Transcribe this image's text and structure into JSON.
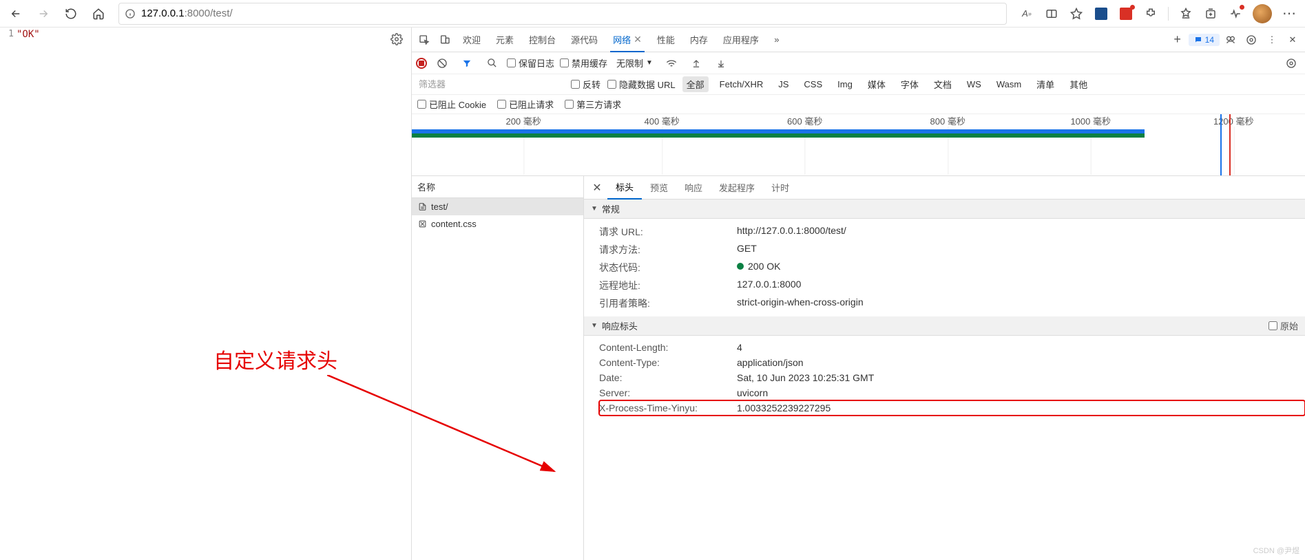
{
  "browser": {
    "url_host": "127.0.0.1",
    "url_port_path": ":8000/test/",
    "reader_label": "A",
    "issue_count": "14"
  },
  "page": {
    "line_no": "1",
    "body": "\"OK\"",
    "annotation": "自定义请求头",
    "watermark": "CSDN @尹煜"
  },
  "devtools": {
    "tabs": [
      "欢迎",
      "元素",
      "控制台",
      "源代码",
      "网络",
      "性能",
      "内存",
      "应用程序"
    ],
    "active_tab_index": 4,
    "toolbar": {
      "preserve_log": "保留日志",
      "disable_cache": "禁用缓存",
      "throttle": "无限制"
    },
    "filter": {
      "placeholder": "筛选器",
      "invert": "反转",
      "hide_data_urls": "隐藏数据 URL",
      "types": [
        "全部",
        "Fetch/XHR",
        "JS",
        "CSS",
        "Img",
        "媒体",
        "字体",
        "文档",
        "WS",
        "Wasm",
        "清单",
        "其他"
      ]
    },
    "cookies": {
      "blocked_cookies": "已阻止 Cookie",
      "blocked_requests": "已阻止请求",
      "third_party": "第三方请求"
    },
    "waterfall": {
      "ticks": [
        "200 毫秒",
        "400 毫秒",
        "600 毫秒",
        "800 毫秒",
        "1000 毫秒",
        "1200 毫秒"
      ]
    },
    "requests": {
      "col_name": "名称",
      "items": [
        "test/",
        "content.css"
      ]
    },
    "detail_tabs": [
      "标头",
      "预览",
      "响应",
      "发起程序",
      "计时"
    ],
    "general": {
      "title": "常规",
      "rows": [
        {
          "k": "请求 URL:",
          "v": "http://127.0.0.1:8000/test/"
        },
        {
          "k": "请求方法:",
          "v": "GET"
        },
        {
          "k": "状态代码:",
          "v": "200 OK",
          "dot": true
        },
        {
          "k": "远程地址:",
          "v": "127.0.0.1:8000"
        },
        {
          "k": "引用者策略:",
          "v": "strict-origin-when-cross-origin"
        }
      ]
    },
    "response_headers": {
      "title": "响应标头",
      "raw": "原始",
      "rows": [
        {
          "k": "Content-Length:",
          "v": "4"
        },
        {
          "k": "Content-Type:",
          "v": "application/json"
        },
        {
          "k": "Date:",
          "v": "Sat, 10 Jun 2023 10:25:31 GMT"
        },
        {
          "k": "Server:",
          "v": "uvicorn"
        },
        {
          "k": "X-Process-Time-Yinyu:",
          "v": "1.0033252239227295"
        }
      ]
    }
  }
}
